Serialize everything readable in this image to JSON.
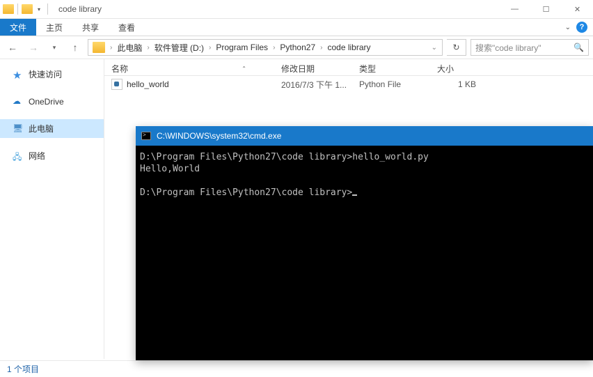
{
  "titlebar": {
    "title": "code library"
  },
  "ribbon": {
    "file": "文件",
    "home": "主页",
    "share": "共享",
    "view": "查看"
  },
  "breadcrumb": {
    "items": [
      "此电脑",
      "软件管理 (D:)",
      "Program Files",
      "Python27",
      "code library"
    ]
  },
  "search": {
    "placeholder": "搜索\"code library\""
  },
  "sidebar": {
    "quickaccess": "快速访问",
    "onedrive": "OneDrive",
    "thispc": "此电脑",
    "network": "网络"
  },
  "columns": {
    "name": "名称",
    "date": "修改日期",
    "type": "类型",
    "size": "大小"
  },
  "files": [
    {
      "name": "hello_world",
      "date": "2016/7/3 下午 1...",
      "type": "Python File",
      "size": "1 KB"
    }
  ],
  "statusbar": {
    "text": "1 个项目"
  },
  "cmd": {
    "title": "C:\\WINDOWS\\system32\\cmd.exe",
    "line1": "D:\\Program Files\\Python27\\code library>hello_world.py",
    "line2": "Hello,World",
    "line3": "D:\\Program Files\\Python27\\code library>"
  }
}
